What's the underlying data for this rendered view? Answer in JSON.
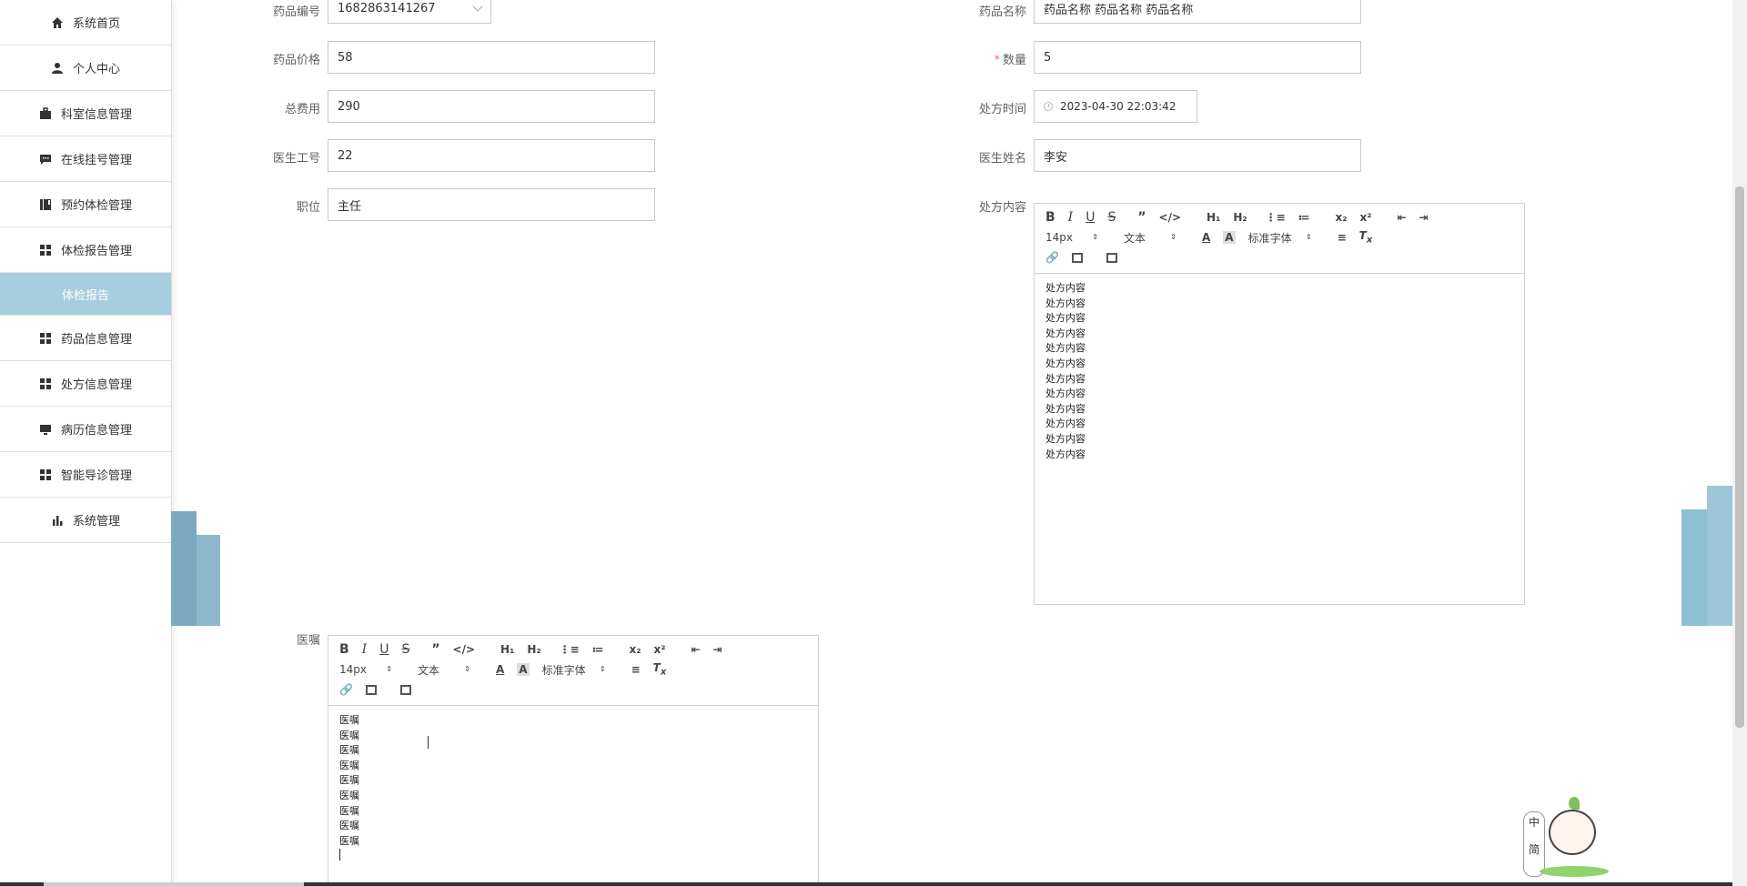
{
  "sidebar": {
    "items": [
      {
        "label": "系统首页",
        "icon": "home-icon"
      },
      {
        "label": "个人中心",
        "icon": "user-icon"
      },
      {
        "label": "科室信息管理",
        "icon": "briefcase-icon"
      },
      {
        "label": "在线挂号管理",
        "icon": "chat-icon"
      },
      {
        "label": "预约体检管理",
        "icon": "book-icon"
      },
      {
        "label": "体检报告管理",
        "icon": "grid-icon"
      },
      {
        "label": "体检报告",
        "icon": "",
        "sub": true
      },
      {
        "label": "药品信息管理",
        "icon": "grid-icon"
      },
      {
        "label": "处方信息管理",
        "icon": "grid-icon"
      },
      {
        "label": "病历信息管理",
        "icon": "monitor-icon"
      },
      {
        "label": "智能导诊管理",
        "icon": "grid-icon"
      },
      {
        "label": "系统管理",
        "icon": "bar-chart-icon"
      }
    ]
  },
  "form": {
    "drug_code": {
      "label": "药品编号",
      "value": "1682863141267"
    },
    "drug_name": {
      "label": "药品名称",
      "value": "药品名称 药品名称 药品名称"
    },
    "drug_price": {
      "label": "药品价格",
      "value": "58"
    },
    "quantity": {
      "label": "数量",
      "value": "5",
      "required_mark": "*"
    },
    "total_cost": {
      "label": "总费用",
      "value": "290"
    },
    "prescription_time": {
      "label": "处方时间",
      "value": "2023-04-30 22:03:42"
    },
    "doctor_id": {
      "label": "医生工号",
      "value": "22"
    },
    "doctor_name": {
      "label": "医生姓名",
      "value": "李安"
    },
    "position": {
      "label": "职位",
      "value": "主任"
    },
    "prescription_content": {
      "label": "处方内容"
    },
    "advice": {
      "label": "医嘱"
    }
  },
  "editor_toolbar": {
    "font_size": "14px",
    "header": "文本",
    "font": "标准字体"
  },
  "prescription_lines": [
    "处方内容",
    "处方内容",
    "处方内容",
    "处方内容",
    "处方内容",
    "处方内容",
    "处方内容",
    "处方内容",
    "处方内容",
    "处方内容",
    "处方内容",
    "处方内容"
  ],
  "advice_lines": [
    "医嘱",
    "医嘱",
    "医嘱",
    "医嘱",
    "医嘱",
    "医嘱",
    "医嘱",
    "医嘱",
    "医嘱"
  ],
  "mascot": {
    "text_top": "中",
    "text_bottom": "简"
  },
  "colors": {
    "sidebar_active": "#a7cede",
    "decor": "#7aa9c0",
    "required": "#f56c6c"
  }
}
